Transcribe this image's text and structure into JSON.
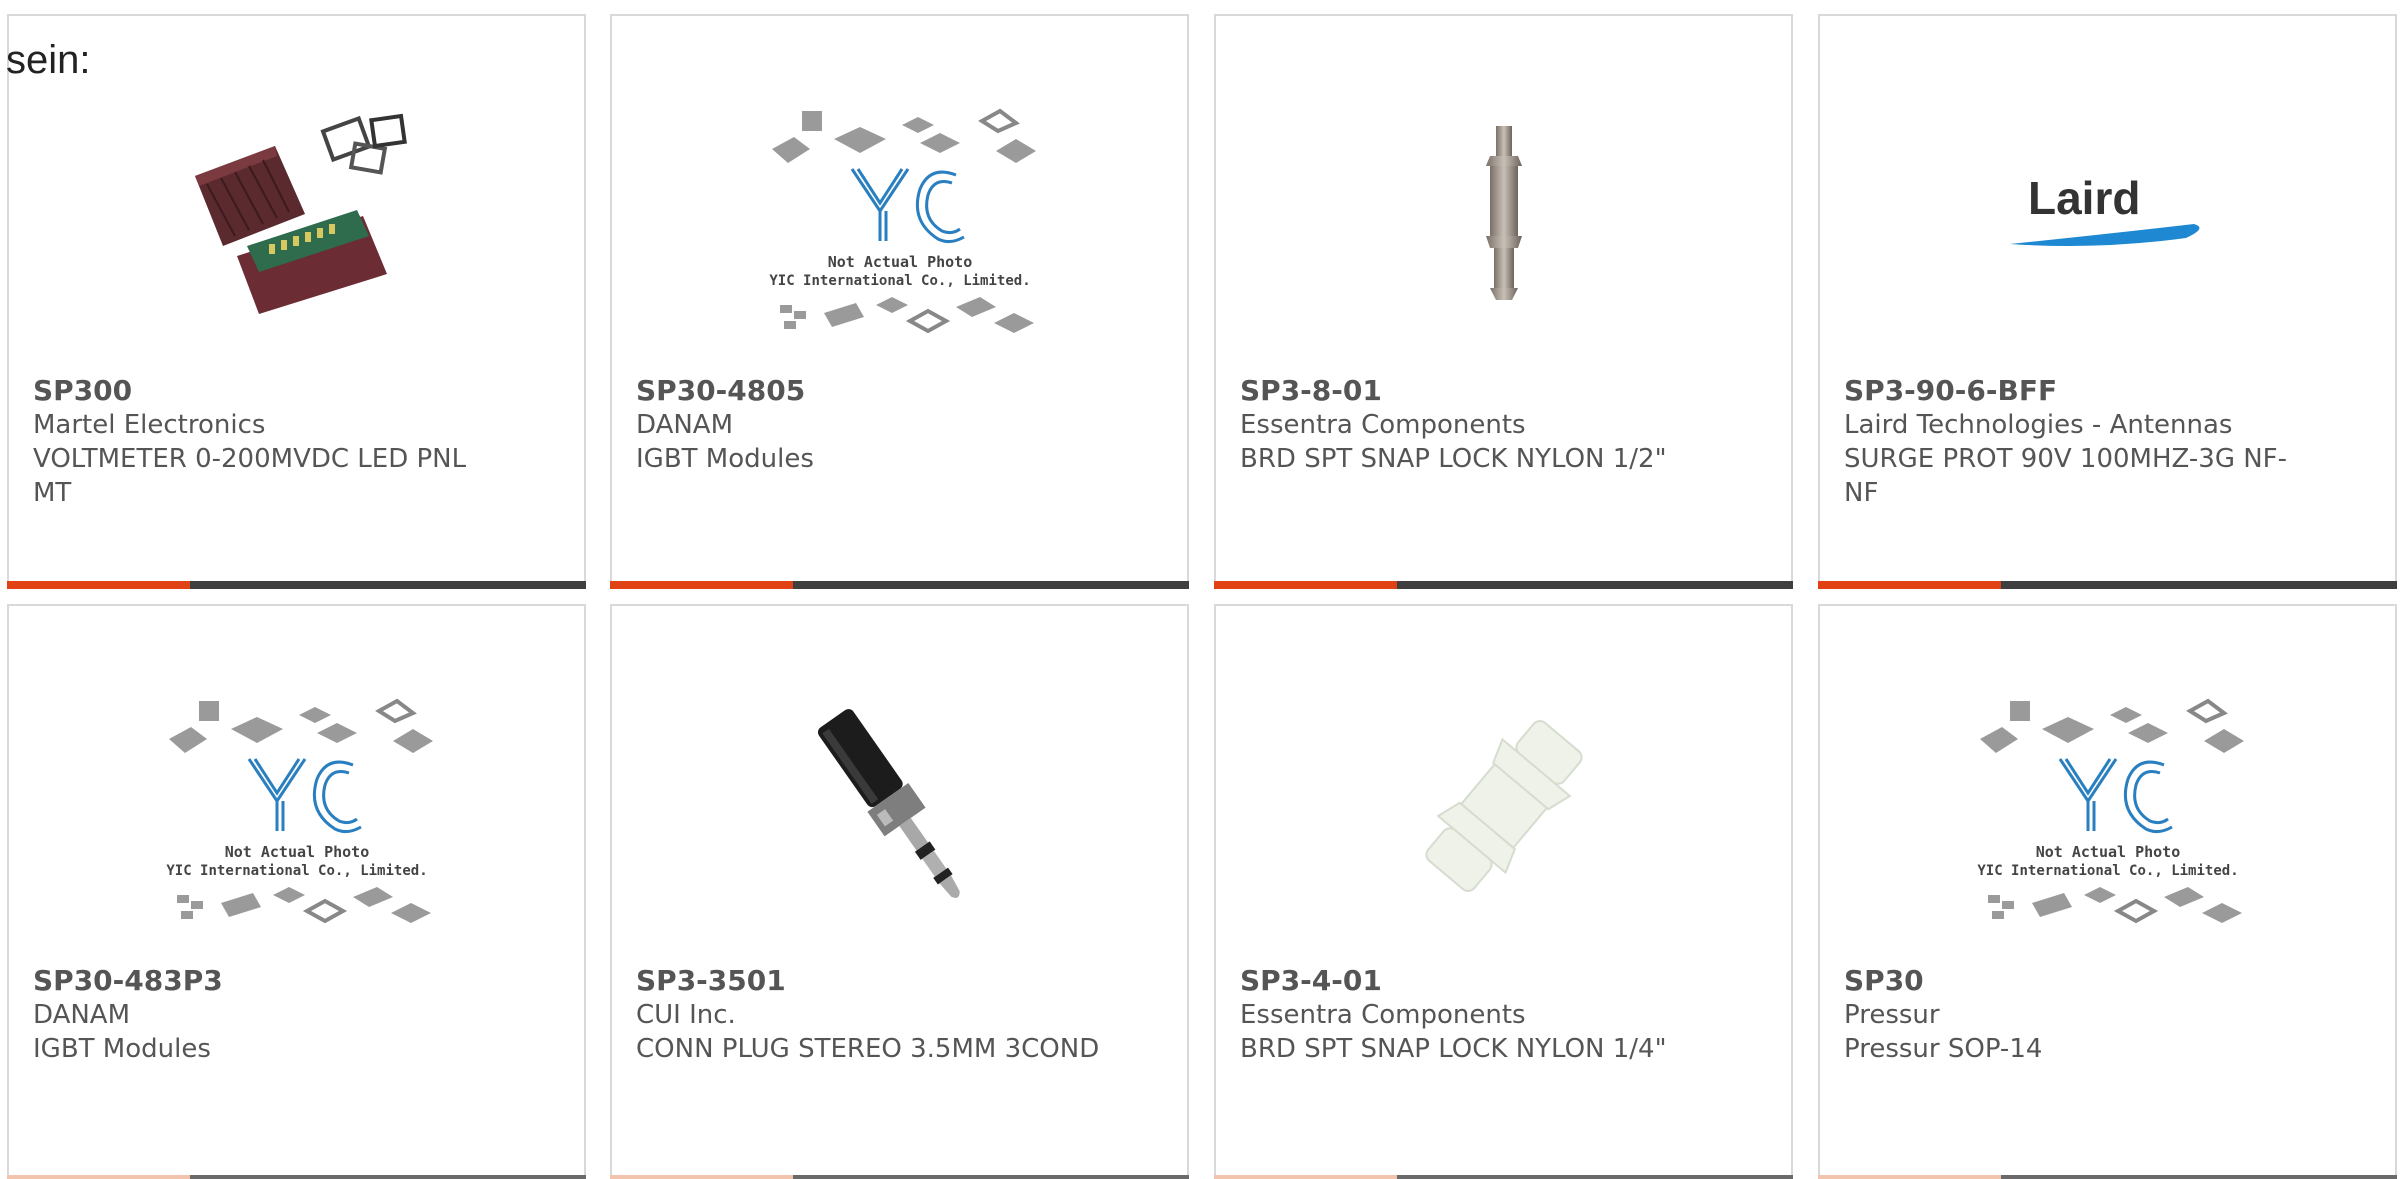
{
  "header": {
    "text": "sein:"
  },
  "colors": {
    "accent": "#e14215",
    "bar": "#3f3f3f",
    "yic_blue": "#2a7fc0"
  },
  "products": [
    {
      "part": "SP300",
      "manufacturer": "Martel Electronics",
      "description": "VOLTMETER 0-200MVDC LED PNL MT",
      "image": "voltmeter-photo"
    },
    {
      "part": "SP30-4805",
      "manufacturer": "DANAM",
      "description": "IGBT Modules",
      "image": "yic-placeholder"
    },
    {
      "part": "SP3-8-01",
      "manufacturer": "Essentra Components",
      "description": "BRD SPT SNAP LOCK NYLON 1/2\"",
      "image": "standoff-photo"
    },
    {
      "part": "SP3-90-6-BFF",
      "manufacturer": "Laird Technologies - Antennas",
      "description": "SURGE PROT 90V 100MHZ-3G NF-NF",
      "image": "laird-logo"
    },
    {
      "part": "SP30-483P3",
      "manufacturer": "DANAM",
      "description": "IGBT Modules",
      "image": "yic-placeholder"
    },
    {
      "part": "SP3-3501",
      "manufacturer": "CUI Inc.",
      "description": "CONN PLUG STEREO 3.5MM 3COND",
      "image": "audio-plug-photo"
    },
    {
      "part": "SP3-4-01",
      "manufacturer": "Essentra Components",
      "description": "BRD SPT SNAP LOCK NYLON 1/4\"",
      "image": "nylon-support-photo"
    },
    {
      "part": "SP30",
      "manufacturer": "Pressur",
      "description": "Pressur SOP-14",
      "image": "yic-placeholder"
    }
  ],
  "yic": {
    "logo": "YIC",
    "line1": "Not Actual Photo",
    "line2": "YIC International Co., Limited."
  },
  "laird": {
    "logo": "Laird"
  }
}
